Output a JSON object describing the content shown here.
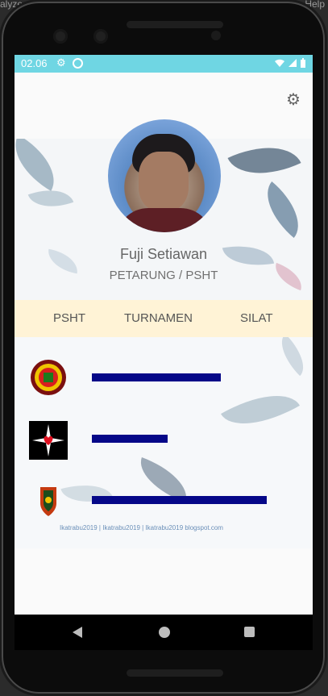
{
  "ide": {
    "left_text": "alyze",
    "right_text": "Help"
  },
  "status_bar": {
    "time": "02.06"
  },
  "profile": {
    "name": "Fuji Setiawan",
    "role": "PETARUNG / PSHT"
  },
  "tabs": [
    {
      "label": "PSHT"
    },
    {
      "label": "TURNAMEN"
    },
    {
      "label": "SILAT"
    }
  ],
  "rows": [
    {
      "logo": "psht-emblem-logo"
    },
    {
      "logo": "heart-star-logo"
    },
    {
      "logo": "shield-emblem-logo"
    }
  ],
  "watermark": "Ikatrabu2019 | Ikatrabu2019 | Ikatrabu2019 blogspot.com",
  "colors": {
    "status_bar": "#6fd6e3",
    "tabs_bg": "#fff3d6",
    "bar": "#050888"
  }
}
